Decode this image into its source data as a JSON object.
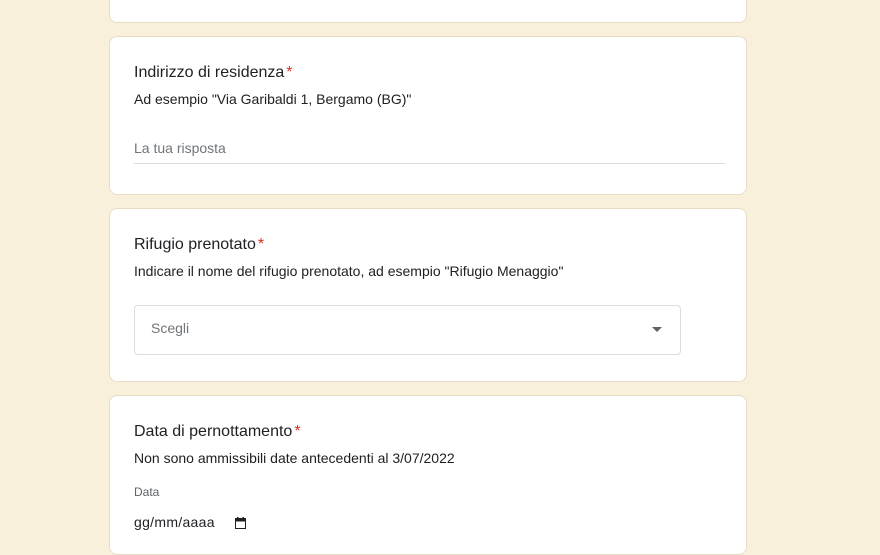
{
  "questions": {
    "address": {
      "title": "Indirizzo di residenza",
      "required_mark": "*",
      "help": "Ad esempio \"Via Garibaldi 1, Bergamo (BG)\"",
      "placeholder": "La tua risposta",
      "value": ""
    },
    "rifugio": {
      "title": "Rifugio prenotato",
      "required_mark": "*",
      "help": "Indicare il nome del rifugio prenotato, ad esempio \"Rifugio Menaggio\"",
      "select_placeholder": "Scegli",
      "icon": "dropdown-caret-icon"
    },
    "date": {
      "title": "Data di pernottamento",
      "required_mark": "*",
      "help": "Non sono ammissibili date antecedenti al 3/07/2022",
      "field_label": "Data",
      "date_placeholder": "gg/mm/aaaa",
      "icon": "calendar-icon"
    }
  },
  "colors": {
    "page_background": "#f9f0dc",
    "required": "#d93025",
    "card_border": "#e7dcc4"
  }
}
